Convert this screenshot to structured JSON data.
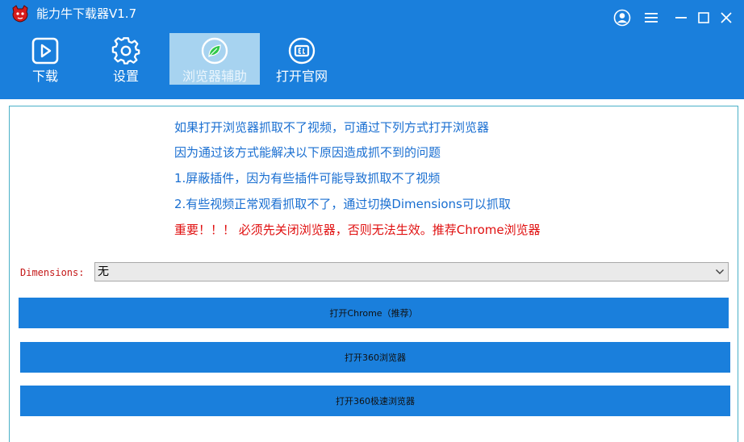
{
  "window": {
    "title": "能力牛下载器V1.7"
  },
  "colors": {
    "brand": "#1a7fdc",
    "active_tab": "#a7d3f0",
    "info_text": "#1a6fd1",
    "warn_text": "#e01010",
    "border": "#4ab0c8"
  },
  "nav": {
    "items": [
      {
        "label": "下载",
        "icon": "play-icon"
      },
      {
        "label": "设置",
        "icon": "gear-icon"
      },
      {
        "label": "浏览器辅助",
        "icon": "leaf-icon",
        "active": true
      },
      {
        "label": "打开官网",
        "icon": "website-icon"
      }
    ]
  },
  "info": {
    "line1": "如果打开浏览器抓取不了视频，可通过下列方式打开浏览器",
    "line2": "因为通过该方式能解决以下原因造成抓不到的问题",
    "line3": "1.屏蔽插件，因为有些插件可能导致抓取不了视频",
    "line4": "2.有些视频正常观看抓取不了，通过切换Dimensions可以抓取",
    "warning": "重要！！！ 必须先关闭浏览器，否则无法生效。推荐Chrome浏览器"
  },
  "dimensions": {
    "label": "Dimensions:",
    "selected": "无"
  },
  "buttons": {
    "chrome": "打开Chrome（推荐）",
    "b360": "打开360浏览器",
    "b360_speed": "打开360极速浏览器"
  }
}
